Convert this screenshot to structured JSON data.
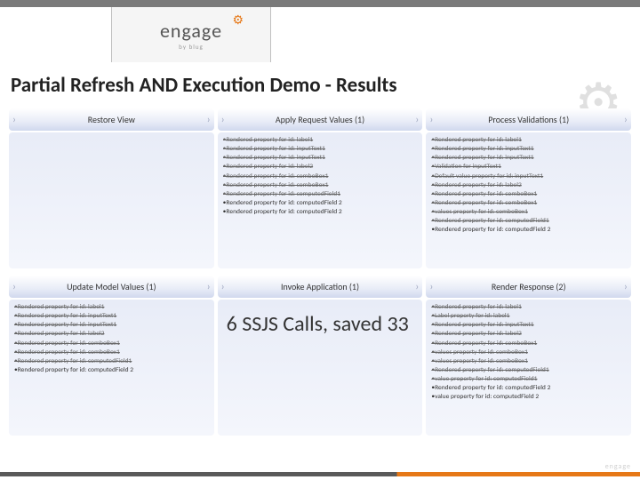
{
  "logo": {
    "text": "engage",
    "sub": "by blug"
  },
  "title": "Partial Refresh AND Execution Demo - Results",
  "phases": [
    {
      "header": "Restore View",
      "items": []
    },
    {
      "header": "Apply Request Values (1)",
      "items": [
        {
          "text": "•Rendered property for id: label1",
          "strike": true
        },
        {
          "text": "•Rendered property for id: inputText1",
          "strike": true
        },
        {
          "text": "•Rendered property for id: inputText1",
          "strike": true
        },
        {
          "text": "•Rendered property for id: label2",
          "strike": true
        },
        {
          "text": "•Rendered property for id: comboBox1",
          "strike": true
        },
        {
          "text": "•Rendered property for id: comboBox1",
          "strike": true
        },
        {
          "text": "•Rendered property for id: computedField1",
          "strike": true
        },
        {
          "text": "•Rendered property for id: computedField 2",
          "strike": false
        },
        {
          "text": "•Rendered property for id: computedField 2",
          "strike": false
        }
      ]
    },
    {
      "header": "Process Validations (1)",
      "items": [
        {
          "text": "•Rendered property for id: label1",
          "strike": true
        },
        {
          "text": "•Rendered property for id: inputText1",
          "strike": true
        },
        {
          "text": "•Rendered property for id: inputText1",
          "strike": true
        },
        {
          "text": "•Validation for inputText1",
          "strike": true
        },
        {
          "text": "•Default value property for id: inputText1",
          "strike": true
        },
        {
          "text": "•Rendered property for id: label2",
          "strike": true
        },
        {
          "text": "•Rendered property for id: comboBox1",
          "strike": true
        },
        {
          "text": "•Rendered property for id: comboBox1",
          "strike": true
        },
        {
          "text": "•values property for id: comboBox1",
          "strike": true
        },
        {
          "text": "•Rendered property for id: computedField1",
          "strike": true
        },
        {
          "text": "•Rendered property for id: computedField 2",
          "strike": false
        }
      ]
    },
    {
      "header": "Update Model Values (1)",
      "items": [
        {
          "text": "•Rendered property for id: label1",
          "strike": true
        },
        {
          "text": "•Rendered property for id: inputText1",
          "strike": true
        },
        {
          "text": "•Rendered property for id: inputText1",
          "strike": true
        },
        {
          "text": "•Rendered property for id: label2",
          "strike": true
        },
        {
          "text": "•Rendered property for id: comboBox1",
          "strike": true
        },
        {
          "text": "•Rendered property for id: comboBox1",
          "strike": true
        },
        {
          "text": "•Rendered property for id: computedField1",
          "strike": true
        },
        {
          "text": "•Rendered property for id: computedField 2",
          "strike": false
        }
      ]
    },
    {
      "header": "Invoke Application (1)",
      "result": "6 SSJS Calls, saved 33"
    },
    {
      "header": "Render Response (2)",
      "items": [
        {
          "text": "•Rendered property for id: label1",
          "strike": true
        },
        {
          "text": "•Label property for id: label1",
          "strike": true
        },
        {
          "text": "•Rendered property for id: inputText1",
          "strike": true
        },
        {
          "text": "•Rendered property for id: label2",
          "strike": true
        },
        {
          "text": "•Rendered property for id: comboBox1",
          "strike": true
        },
        {
          "text": "•values property for id: comboBox1",
          "strike": true
        },
        {
          "text": "•values property for id: comboBox1",
          "strike": true
        },
        {
          "text": "•Rendered property for id: computedField1",
          "strike": true
        },
        {
          "text": "•value property for id: computedField1",
          "strike": true
        },
        {
          "text": "•Rendered property for id: computedField 2",
          "strike": false
        },
        {
          "text": "•value property for id: computedField 2",
          "strike": false
        }
      ]
    }
  ],
  "watermark": "engage"
}
